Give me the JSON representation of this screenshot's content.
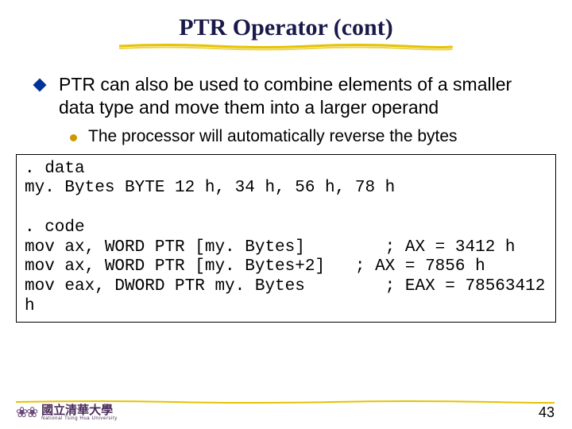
{
  "slide": {
    "title": "PTR Operator (cont)",
    "bullet1": "PTR can also be used to combine elements of a smaller data type and move them into a larger operand",
    "bullet2": "The processor will automatically reverse the bytes",
    "code": ". data\nmy. Bytes BYTE 12 h, 34 h, 56 h, 78 h\n\n. code\nmov ax, WORD PTR [my. Bytes]        ; AX = 3412 h\nmov ax, WORD PTR [my. Bytes+2]   ; AX = 7856 h\nmov eax, DWORD PTR my. Bytes        ; EAX = 78563412 h"
  },
  "footer": {
    "logo_cn": "國立清華大學",
    "logo_en": "National Tsing Hua University",
    "page_number": "43"
  }
}
